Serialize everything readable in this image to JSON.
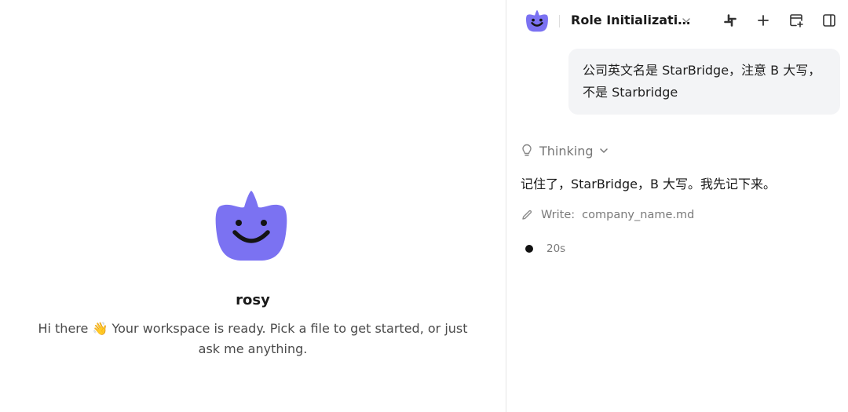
{
  "welcome": {
    "agent_name": "rosy",
    "message": "Hi there 👋 Your workspace is ready. Pick a file to get started, or just ask me anything."
  },
  "chat": {
    "header": {
      "title": "Role Initializati…",
      "icons": [
        "slack-icon",
        "plus-icon",
        "new-window-icon",
        "sidebar-toggle-icon"
      ]
    },
    "user_message": "公司英文名是 StarBridge，注意 B 大写，不是 Starbridge",
    "thinking_label": "Thinking",
    "assistant_reply": "记住了，StarBridge，B 大写。我先记下来。",
    "tool_call": {
      "verb": "Write:",
      "file": "company_name.md"
    },
    "elapsed": "20s"
  },
  "colors": {
    "mascot": "#7b72f2",
    "bubble_bg": "#f3f4f6",
    "divider": "#e6e6e6",
    "muted_text": "#7a7a7a"
  }
}
